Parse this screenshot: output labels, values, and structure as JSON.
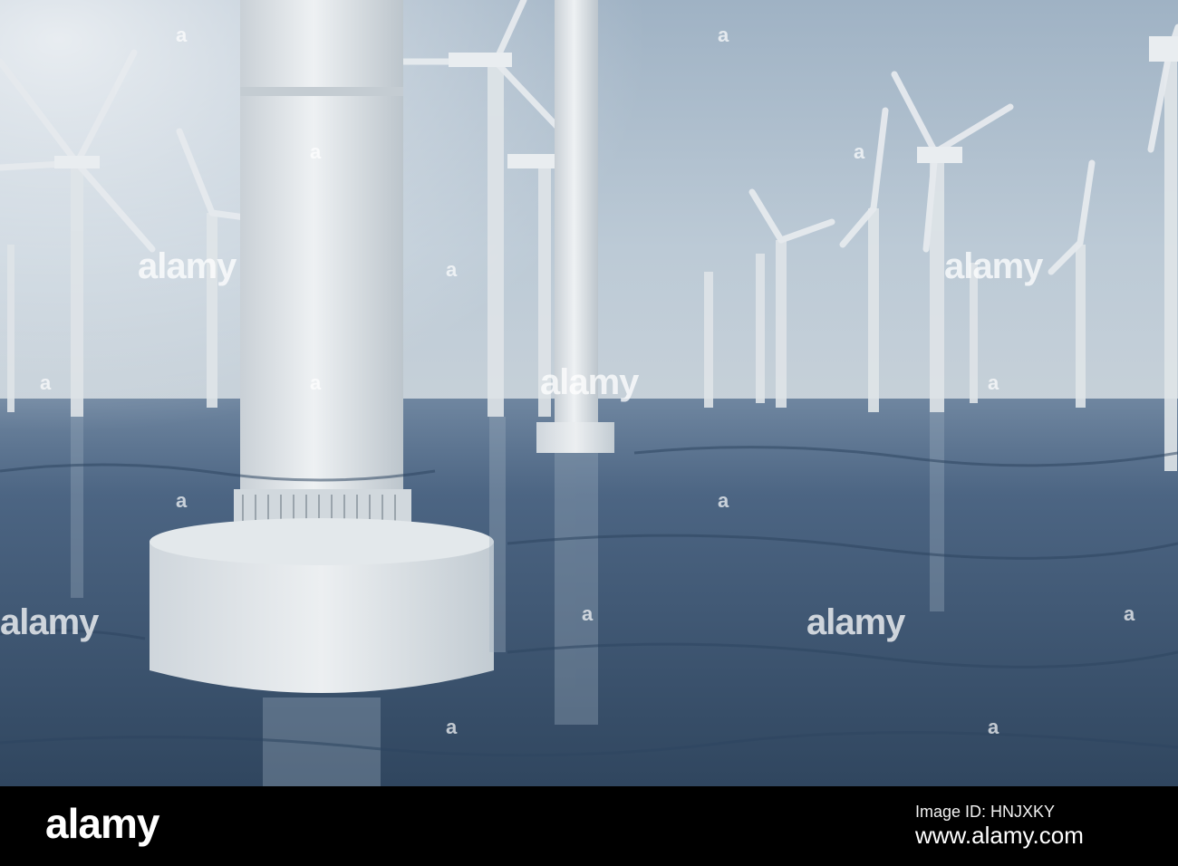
{
  "footer": {
    "brand": "alamy",
    "image_id_label": "Image ID: HNJXKY",
    "site": "www.alamy.com"
  },
  "watermark": {
    "text": "alamy",
    "mark": "a"
  },
  "colors": {
    "sky_top": "#a9b9c8",
    "sky_bottom": "#c6d0d8",
    "sea": "#3f5774",
    "turbine": "#e3e7ea",
    "footer": "#000000"
  }
}
